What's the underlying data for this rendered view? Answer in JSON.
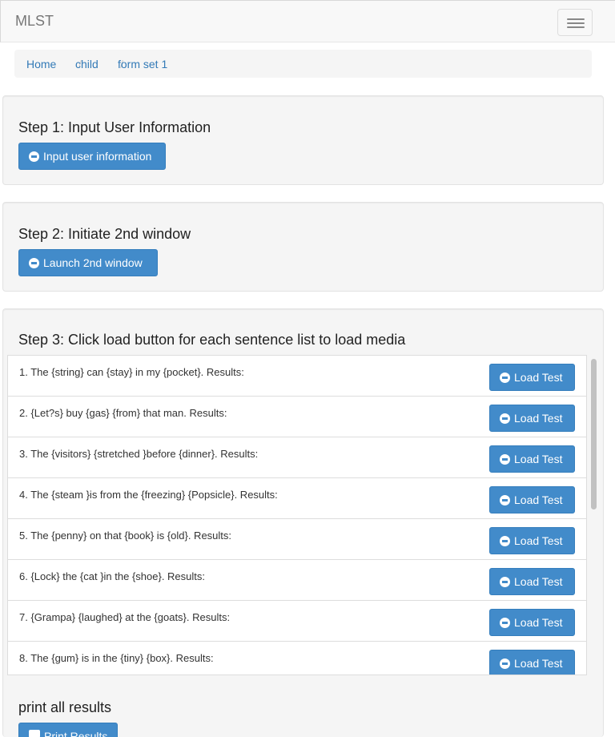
{
  "navbar": {
    "brand": "MLST",
    "toggle_icon": "hamburger-icon"
  },
  "breadcrumb": {
    "items": [
      "Home",
      "child",
      "form set 1"
    ],
    "separator": "/"
  },
  "step1": {
    "title": "Step 1: Input User Information",
    "button_label": "Input user information"
  },
  "step2": {
    "title": "Step 2: Initiate 2nd window",
    "button_label": "Launch 2nd window"
  },
  "step3": {
    "title": "Step 3: Click load button for each sentence list to load media",
    "load_label": "Load Test",
    "items": [
      "1. The {string} can {stay} in my {pocket}. Results:",
      "2. {Let?s} buy {gas} {from} that man. Results:",
      "3. The {visitors} {stretched }before {dinner}. Results:",
      "4. The {steam }is from the {freezing} {Popsicle}. Results:",
      "5. The {penny} on that {book} is {old}. Results:",
      "6. {Lock} the {cat }in the {shoe}. Results:",
      "7. {Grampa} {laughed} at the {goats}. Results:",
      "8. The {gum} is in the {tiny} {box}. Results:"
    ]
  },
  "print": {
    "title": "print all results",
    "button_label": "Print Results"
  },
  "colors": {
    "primary": "#428bca",
    "link": "#337ab7",
    "well": "#f5f5f5"
  }
}
